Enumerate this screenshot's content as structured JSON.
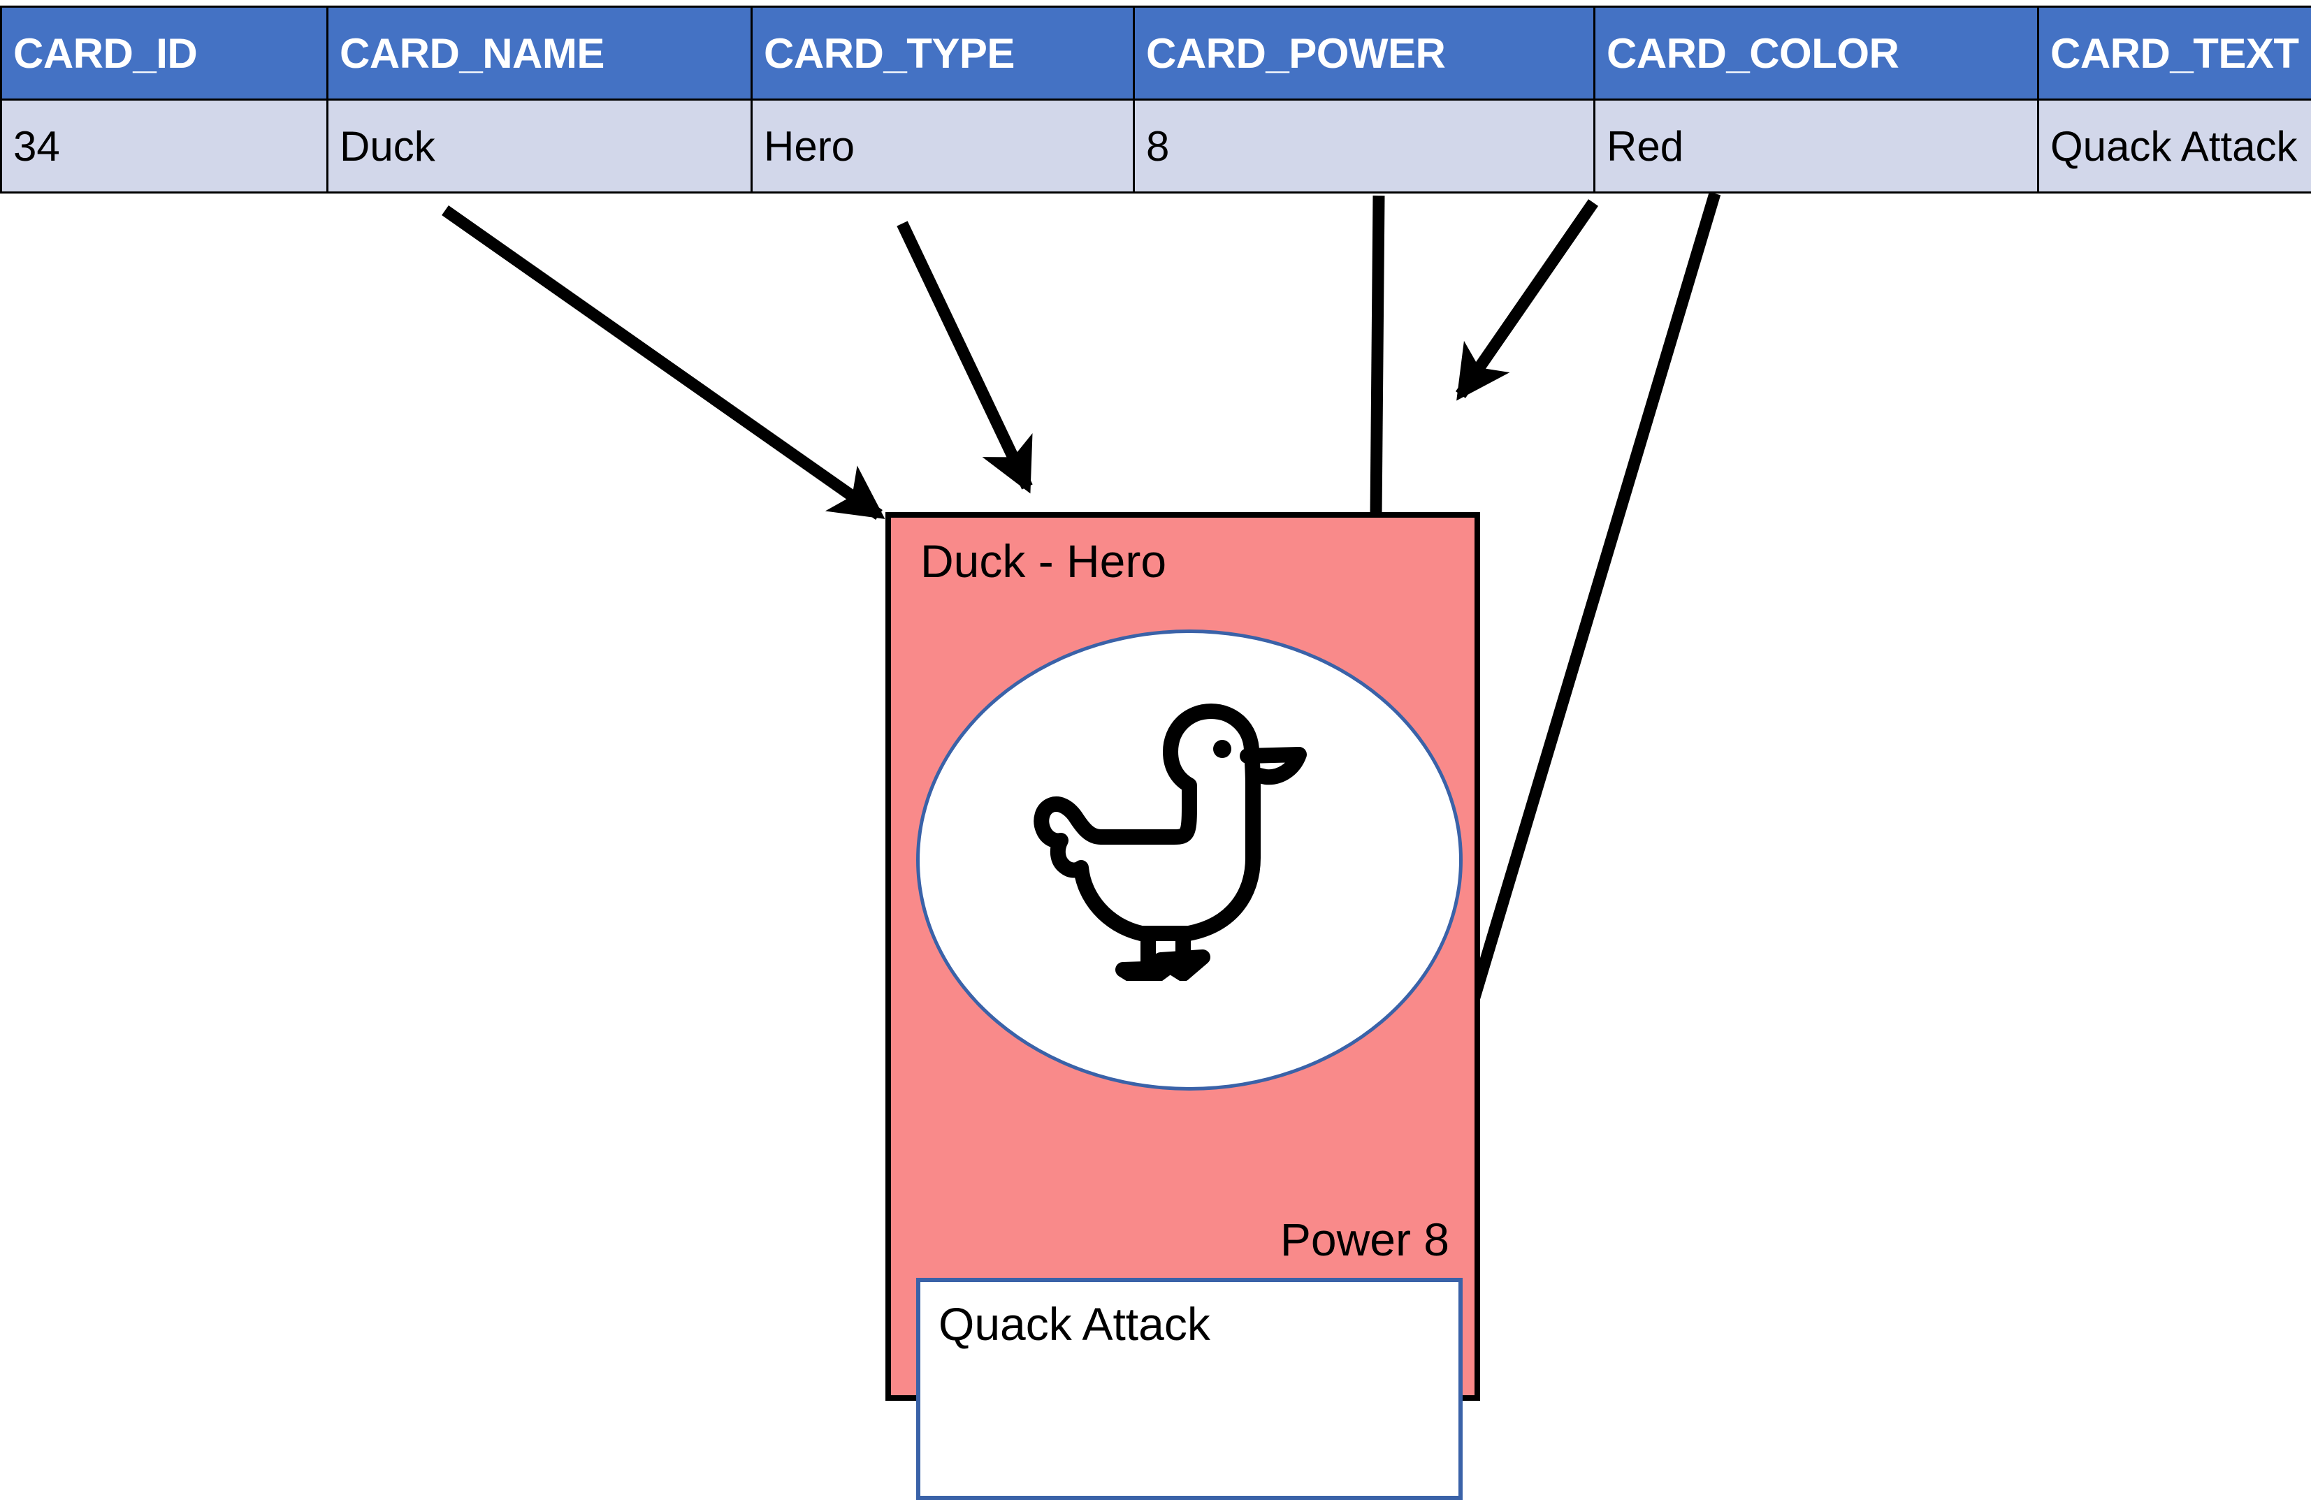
{
  "table": {
    "columns": [
      {
        "key": "card_id",
        "header": "CARD_ID",
        "value": "34"
      },
      {
        "key": "card_name",
        "header": "CARD_NAME",
        "value": "Duck"
      },
      {
        "key": "card_type",
        "header": "CARD_TYPE",
        "value": "Hero"
      },
      {
        "key": "card_power",
        "header": "CARD_POWER",
        "value": "8"
      },
      {
        "key": "card_color",
        "header": "CARD_COLOR",
        "value": "Red"
      },
      {
        "key": "card_text",
        "header": "CARD_TEXT",
        "value": "Quack Attack"
      }
    ],
    "header_bg": "#4472c4",
    "header_fg": "#ffffff",
    "row_bg": "#d2d7ea",
    "row_fg": "#000000",
    "border": "#000000"
  },
  "card": {
    "title": "Duck - Hero",
    "power_label": "Power 8",
    "rules_text": "Quack Attack",
    "background": "#f98a8a",
    "border": "#000000",
    "art_outline": "#3a62a8",
    "art_fill": "#ffffff",
    "textbox_border": "#3a62a8",
    "textbox_fill": "#ffffff",
    "art_icon": "duck-icon"
  },
  "arrows": [
    {
      "name": "arrow-card-name-to-card-body",
      "from_column": "CARD_NAME",
      "to": "card-body"
    },
    {
      "name": "arrow-card-type-to-card-title",
      "from_column": "CARD_TYPE",
      "to": "card-title"
    },
    {
      "name": "arrow-card-power-to-power",
      "from_column": "CARD_POWER",
      "to": "card-power"
    },
    {
      "name": "arrow-card-color-to-card-frame",
      "from_column": "CARD_COLOR",
      "to": "card-frame"
    },
    {
      "name": "arrow-card-text-to-textbox",
      "from_column": "CARD_TEXT",
      "to": "card-textbox"
    }
  ],
  "colors": {
    "accent_blue": "#4472c4",
    "light_blue": "#d2d7ea",
    "card_red": "#f98a8a",
    "outline_blue": "#3a62a8",
    "black": "#000000",
    "white": "#ffffff"
  }
}
